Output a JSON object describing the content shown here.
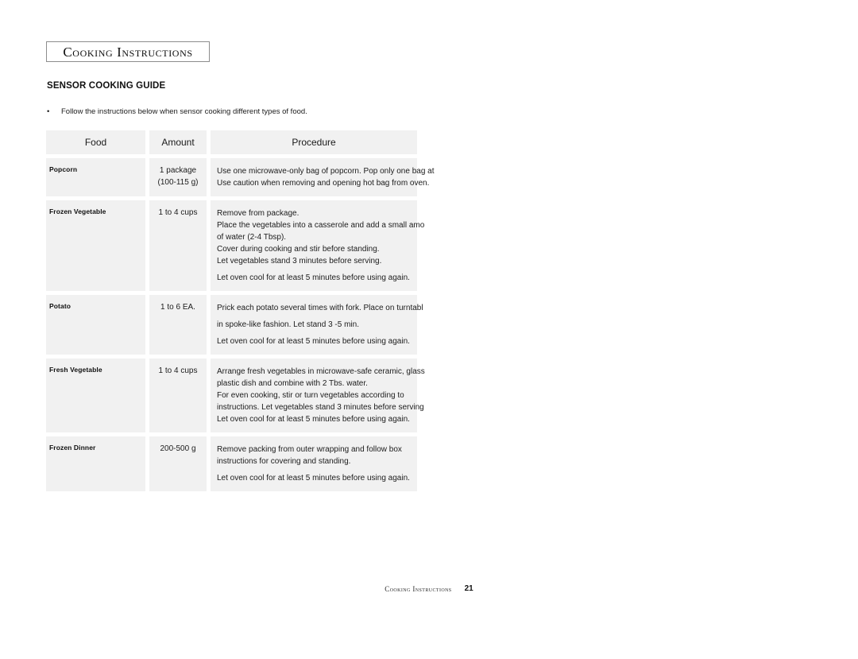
{
  "section": {
    "title": "Cooking Instructions"
  },
  "heading": "SENSOR COOKING GUIDE",
  "intro": {
    "bullet_mark": "•",
    "text": "Follow the instructions below when sensor cooking different types of food."
  },
  "table": {
    "columns": [
      "Food",
      "Amount",
      "Procedure"
    ],
    "rows": [
      {
        "food": "Popcorn",
        "amount": [
          "1 package",
          "(100-115 g)"
        ],
        "procedure": [
          {
            "text": "Use one microwave-only bag of popcorn. Pop only one bag at a t",
            "spaced": false
          },
          {
            "text": "Use caution when removing and opening hot bag from oven.",
            "spaced": false
          }
        ]
      },
      {
        "food": "Frozen Vegetable",
        "amount": [
          "1 to 4 cups"
        ],
        "procedure": [
          {
            "text": "Remove from package.",
            "spaced": false
          },
          {
            "text": "Place the vegetables into a casserole and add a small amo",
            "spaced": false
          },
          {
            "text": "of water (2-4 Tbsp).",
            "spaced": false
          },
          {
            "text": "Cover during cooking and stir before standing.",
            "spaced": false
          },
          {
            "text": "Let vegetables stand 3 minutes before serving.",
            "spaced": false
          },
          {
            "text": "Let oven cool for at least 5 minutes before using again.",
            "spaced": true
          }
        ]
      },
      {
        "food": "Potato",
        "amount": [
          "1 to 6 EA."
        ],
        "procedure": [
          {
            "text": "Prick each potato several times with fork. Place on turntabl",
            "spaced": false
          },
          {
            "text": "in spoke-like fashion. Let stand 3 -5 min.",
            "spaced": true
          },
          {
            "text": "Let oven cool for at least 5 minutes before using again.",
            "spaced": true
          }
        ]
      },
      {
        "food": "Fresh Vegetable",
        "amount": [
          "1 to 4 cups"
        ],
        "procedure": [
          {
            "text": "Arrange fresh vegetables in microwave-safe ceramic, glass",
            "spaced": false
          },
          {
            "text": "plastic dish and combine with 2 Tbs. water.",
            "spaced": false
          },
          {
            "text": "For even cooking, stir or turn vegetables according to",
            "spaced": false
          },
          {
            "text": "instructions. Let vegetables stand 3 minutes before serving",
            "spaced": false
          },
          {
            "text": "Let oven cool for at least 5 minutes before using again.",
            "spaced": false
          }
        ]
      },
      {
        "food": "Frozen Dinner",
        "amount": [
          "200-500 g"
        ],
        "procedure": [
          {
            "text": "Remove packing from outer wrapping and follow box",
            "spaced": false
          },
          {
            "text": "instructions for covering and standing.",
            "spaced": false
          },
          {
            "text": "Let oven cool for at least 5 minutes before using again.",
            "spaced": true
          }
        ]
      }
    ]
  },
  "footer": {
    "title": "Cooking Instructions",
    "page_number": "21"
  },
  "colors": {
    "cell_background": "#f1f1f1",
    "title_border": "#8d8d8d",
    "text": "#1c1c1c",
    "page_background": "#ffffff"
  }
}
